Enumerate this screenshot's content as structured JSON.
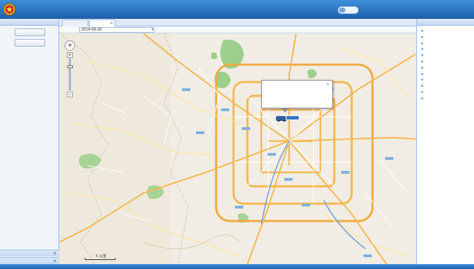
{
  "header": {
    "system_title": "",
    "system_subtitle": "",
    "map_toggle_label": "",
    "user_info": ""
  },
  "left_panel": {
    "title": "",
    "buttons": [
      {
        "label": ""
      },
      {
        "label": ""
      }
    ],
    "accordion": [
      {
        "label": ""
      },
      {
        "label": ""
      }
    ]
  },
  "tabs": [
    {
      "label": ""
    },
    {
      "label": ""
    }
  ],
  "filter": {
    "label": "",
    "date_value": "2014-08-28"
  },
  "map": {
    "popup": {
      "title": "",
      "line1": "",
      "line2": ""
    },
    "scale_label": "5 公里",
    "copyright": ""
  },
  "right_panel": {
    "title": "",
    "vehicles": [
      {
        "label": ""
      },
      {
        "label": ""
      },
      {
        "label": ""
      },
      {
        "label": ""
      },
      {
        "label": ""
      },
      {
        "label": ""
      },
      {
        "label": ""
      },
      {
        "label": ""
      },
      {
        "label": ""
      },
      {
        "label": ""
      },
      {
        "label": ""
      },
      {
        "label": ""
      }
    ]
  },
  "colors": {
    "header": "#1e62b0",
    "panel_border": "#99bbe8",
    "map_land": "#f1ede4",
    "map_green": "#9ccf8c",
    "map_road_major": "#f5b84f",
    "map_road_minor": "#ffffff"
  },
  "icons": {
    "logo": "police-badge-icon",
    "calendar": "calendar-icon",
    "close": "close-icon",
    "pan": "pan-control-icon",
    "vehicle": "vehicle-marker-icon"
  }
}
